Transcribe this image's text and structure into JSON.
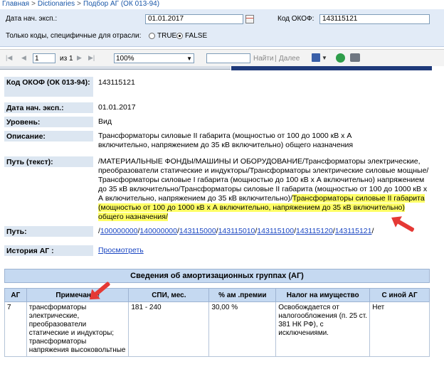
{
  "breadcrumb": [
    "Главная",
    "Dictionaries",
    "Подбор АГ (ОК 013-94)"
  ],
  "filter": {
    "date_label": "Дата нач. эксп.:",
    "date_value": "01.01.2017",
    "okof_label": "Код ОКОФ:",
    "okof_value": "143115121",
    "only_codes_label": "Только коды, специфичные для отрасли:",
    "radio_true": "TRUE",
    "radio_false": "FALSE",
    "selected": "FALSE"
  },
  "toolbar": {
    "page_value": "1",
    "page_of": "из 1",
    "zoom": "100%",
    "find": "Найти",
    "divider": "|",
    "next": "Далее"
  },
  "details": {
    "code_label": "Код ОКОФ (ОК 013-94):",
    "code_value": "143115121",
    "date_label": "Дата нач. эксп.:",
    "date_value": "01.01.2017",
    "level_label": "Уровень:",
    "level_value": "Вид",
    "desc_label": "Описание:",
    "desc_value": "Трансформаторы силовые II габарита (мощностью от 100 до 1000 кВ х А включительно, напряжением до 35 кВ включительно) общего назначения",
    "path_text_label": "Путь (текст):",
    "path_text_plain": "/МАТЕРИАЛЬНЫЕ ФОНДЫ/МАШИНЫ И ОБОРУДОВАНИЕ/Трансформаторы электрические, преобразователи статические и индукторы/Трансформаторы электрические силовые мощные/Трансформаторы силовые I габарита (мощностью до 100 кВ х А включительно) напряжением до 35 кВ включительно/Трансформаторы силовые II габарита (мощностью от 100 до 1000 кВ х А включительно, напряжением до 35 кВ включительно)/",
    "path_text_highlight": "Трансформаторы силовые II габарита (мощностью от 100 до 1000 кВ х А включительно, напряжением до 35 кВ включительно) общего назначения/",
    "path_label": "Путь:",
    "path_links": [
      "100000000",
      "140000000",
      "143115000",
      "143115010",
      "143115100",
      "143115120",
      "143115121"
    ],
    "history_label": "История АГ :",
    "history_link": "Просмотреть"
  },
  "amort": {
    "title": "Сведения об амортизационных группах (АГ)",
    "columns": [
      "АГ",
      "Примечание",
      "СПИ, мес.",
      "% ам .премии",
      "Налог на имущество",
      "С иной АГ"
    ],
    "row": {
      "ag": "7",
      "note": "трансформаторы электрические, преобразователи статические и индукторы; трансформаторы напряжения высоковольтные",
      "spi": "181 - 240",
      "premium": "30,00 %",
      "tax": "Освобождается от налогообложения (п. 25 ст. 381 НК РФ), с исключениями.",
      "other": "Нет"
    }
  },
  "colors": {
    "label_bg": "#dce6f1",
    "header_bg": "#c5d9f1",
    "highlight": "#ffff66",
    "arrow": "#e53935",
    "link": "#1a46c2"
  }
}
